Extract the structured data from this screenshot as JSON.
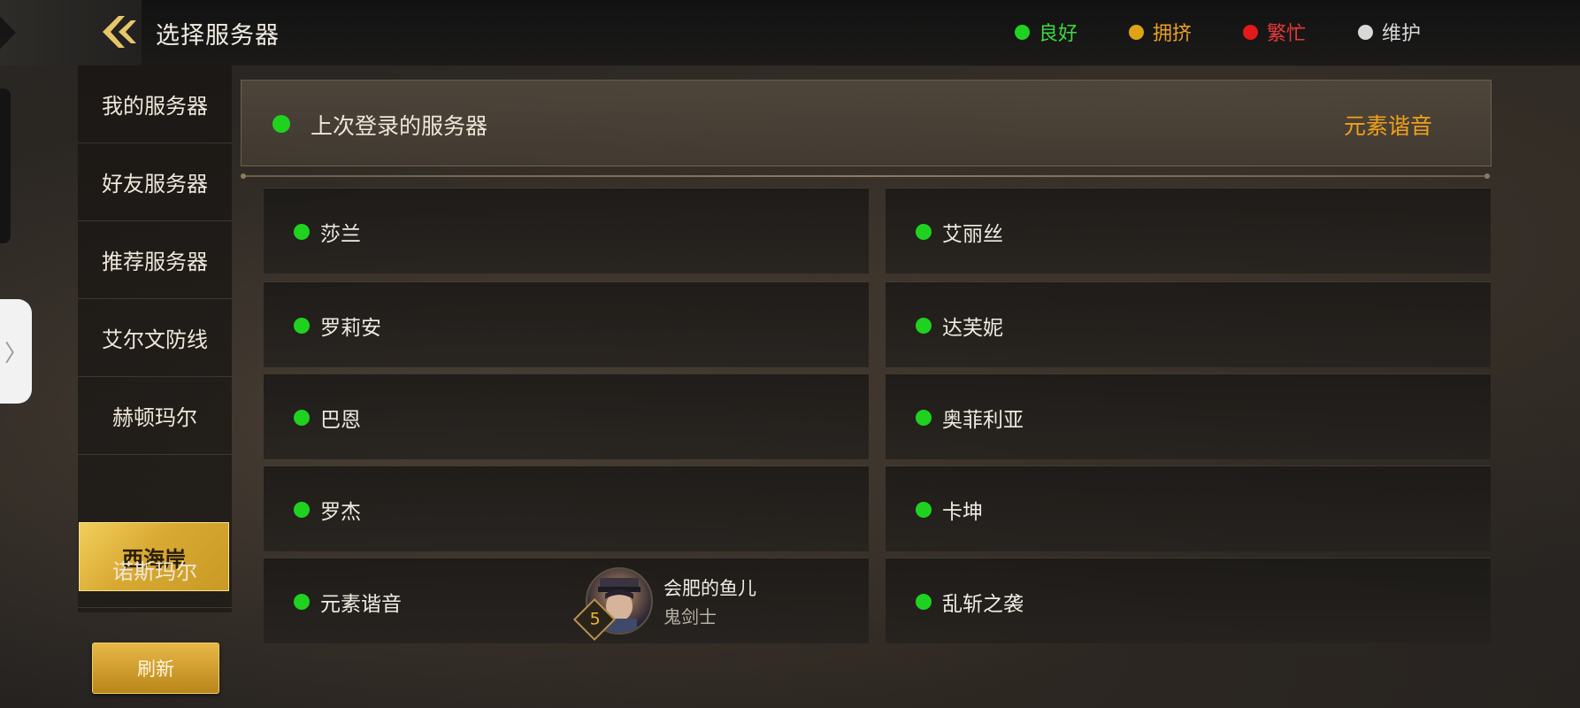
{
  "header": {
    "title": "选择服务器",
    "legend": [
      {
        "label": "良好",
        "color": "#1fd21f",
        "text_color": "#3fd83f"
      },
      {
        "label": "拥挤",
        "color": "#e0a315",
        "text_color": "#e8a025"
      },
      {
        "label": "繁忙",
        "color": "#e21a1a",
        "text_color": "#e83a3a"
      },
      {
        "label": "维护",
        "color": "#d8d8d8",
        "text_color": "#d8d8d8"
      }
    ]
  },
  "sidebar": {
    "items": [
      {
        "label": "我的服务器"
      },
      {
        "label": "好友服务器"
      },
      {
        "label": "推荐服务器"
      },
      {
        "label": "艾尔文防线"
      },
      {
        "label": "赫顿玛尔"
      },
      {
        "label": "西海岸",
        "active": true
      },
      {
        "label": "诺斯玛尔"
      }
    ],
    "refresh_label": "刷新"
  },
  "last_login": {
    "label": "上次登录的服务器",
    "server": "元素谐音"
  },
  "servers": [
    {
      "name": "莎兰",
      "status": "良好"
    },
    {
      "name": "艾丽丝",
      "status": "良好"
    },
    {
      "name": "罗莉安",
      "status": "良好"
    },
    {
      "name": "达芙妮",
      "status": "良好"
    },
    {
      "name": "巴恩",
      "status": "良好"
    },
    {
      "name": "奥菲利亚",
      "status": "良好"
    },
    {
      "name": "罗杰",
      "status": "良好"
    },
    {
      "name": "卡坤",
      "status": "良好"
    },
    {
      "name": "元素谐音",
      "status": "良好",
      "character": {
        "name": "会肥的鱼儿",
        "class": "鬼剑士",
        "level": "5"
      }
    },
    {
      "name": "乱斩之袭",
      "status": "良好"
    }
  ]
}
